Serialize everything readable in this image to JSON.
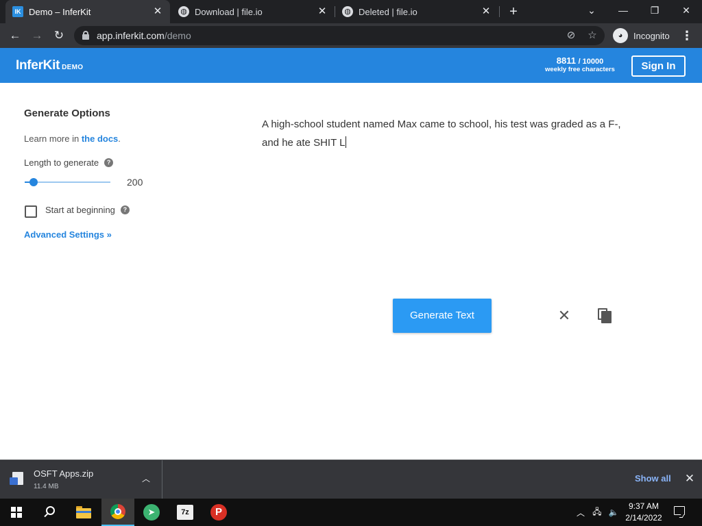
{
  "browser": {
    "tabs": [
      {
        "title": "Demo – InferKit",
        "active": true,
        "favicon": "inferkit-logo-icon",
        "favicon_text": "IK"
      },
      {
        "title": "Download | file.io",
        "active": false,
        "favicon": "globe-icon"
      },
      {
        "title": "Deleted | file.io",
        "active": false,
        "favicon": "globe-icon"
      }
    ],
    "address": {
      "host": "app.inferkit.com",
      "path": "/demo"
    },
    "profile_label": "Incognito",
    "accent_color": "#202124"
  },
  "header": {
    "logo": "InferKit",
    "logo_badge": "DEMO",
    "quota_used": "8811",
    "quota_limit": "/ 10000",
    "quota_caption": "weekly free characters",
    "signin_label": "Sign In",
    "brand_color": "#2585de"
  },
  "options": {
    "title": "Generate Options",
    "learn_prefix": "Learn more in ",
    "learn_link": "the docs",
    "learn_suffix": ".",
    "length_label": "Length to generate",
    "length_value": "200",
    "length_fraction": 0.1,
    "start_label": "Start at beginning",
    "start_checked": false,
    "advanced_label": "Advanced Settings »"
  },
  "prompt": {
    "text": "A high-school student named Max came to school, his test was graded as a F-, and he ate SHIT L"
  },
  "actions": {
    "generate_label": "Generate Text",
    "button_color": "#2b9af3"
  },
  "download_shelf": {
    "file_name": "OSFT Apps.zip",
    "file_size": "11.4 MB",
    "show_all_label": "Show all"
  },
  "taskbar": {
    "time": "9:37 AM",
    "date": "2/14/2022",
    "apps": [
      "start-icon",
      "search-icon",
      "file-explorer-icon",
      "chrome-icon",
      "send-app-icon",
      "7zip-icon",
      "p-app-icon"
    ]
  }
}
